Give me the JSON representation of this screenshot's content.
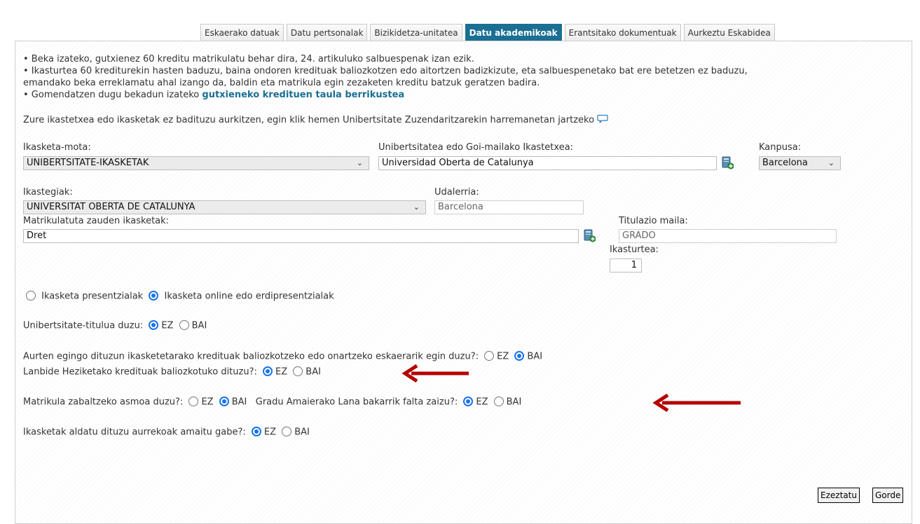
{
  "tabs": [
    {
      "label": "Eskaerako datuak",
      "active": false
    },
    {
      "label": "Datu pertsonalak",
      "active": false
    },
    {
      "label": "Bizikidetza-unitatea",
      "active": false
    },
    {
      "label": "Datu akademikoak",
      "active": true
    },
    {
      "label": "Erantsitako dokumentuak",
      "active": false
    },
    {
      "label": "Aurkeztu Eskabidea",
      "active": false
    }
  ],
  "info": {
    "line1": "• Beka izateko, gutxienez 60 kreditu matrikulatu behar dira, 24. artikuluko salbuespenak izan ezik.",
    "line2": "• Ikasturtea 60 krediturekin hasten baduzu, baina ondoren kredituak baliozkotzen edo aitortzen badizkizute, eta salbuespenetako bat ere betetzen ez baduzu,",
    "line3": "emandako beka erreklamatu ahal izango da, baldin eta matrikula egin zezaketen kreditu batzuk geratzen badira.",
    "line4_prefix": "• Gomendatzen dugu bekadun izateko ",
    "line4_link": "gutxieneko kredituen taula berrikustea",
    "contact": "Zure ikastetxea edo ikasketak ez badituzu aurkitzen, egin klik hemen Unibertsitate Zuzendaritzarekin harremanetan jartzeko"
  },
  "form": {
    "ikasketa_mota_label": "Ikasketa-mota:",
    "ikasketa_mota_value": "UNIBERTSITATE-IKASKETAK",
    "unibertsitatea_label": "Unibertsitatea edo Goi-mailako Ikastetxea:",
    "unibertsitatea_value": "Universidad Oberta de Catalunya",
    "kanpusa_label": "Kanpusa:",
    "kanpusa_value": "Barcelona",
    "ikastegiak_label": "Ikastegiak:",
    "ikastegiak_value": "UNIVERSITAT OBERTA DE CATALUNYA",
    "udalerria_label": "Udalerria:",
    "udalerria_value": "Barcelona",
    "matrikulatuta_label": "Matrikulatuta zauden ikasketak:",
    "matrikulatuta_value": "Dret",
    "titulazio_label": "Titulazio maila:",
    "titulazio_value": "GRADO",
    "ikasturtea_label": "Ikasturtea:",
    "ikasturtea_value": "1"
  },
  "modality": {
    "presential": "Ikasketa presentzialak",
    "online": "Ikasketa online edo erdipresentzialak",
    "selected": "online"
  },
  "questions": {
    "q1": "Unibertsitate-titulua duzu:",
    "q2": "Aurten egingo dituzun ikasketetarako kredituak baliozkotzeko edo onartzeko eskaerarik egin duzu?:",
    "q3": "Lanbide Heziketako kredituak baliozkotuko dituzu?:",
    "q4a": "Matrikula zabaltzeko asmoa duzu?:",
    "q4b": "Gradu Amaierako Lana bakarrik falta zaizu?:",
    "q5": "Ikasketak aldatu dituzu aurrekoak amaitu gabe?:",
    "ez": "EZ",
    "bai": "BAI",
    "answers": {
      "q1": "EZ",
      "q2": "BAI",
      "q3": "EZ",
      "q4a": "BAI",
      "q4b": "EZ",
      "q5": "EZ"
    }
  },
  "buttons": {
    "cancel": "Ezeztatu",
    "save": "Gorde"
  },
  "colors": {
    "accent": "#1a6f93",
    "radio": "#1a73e8",
    "arrow": "#b40000"
  }
}
